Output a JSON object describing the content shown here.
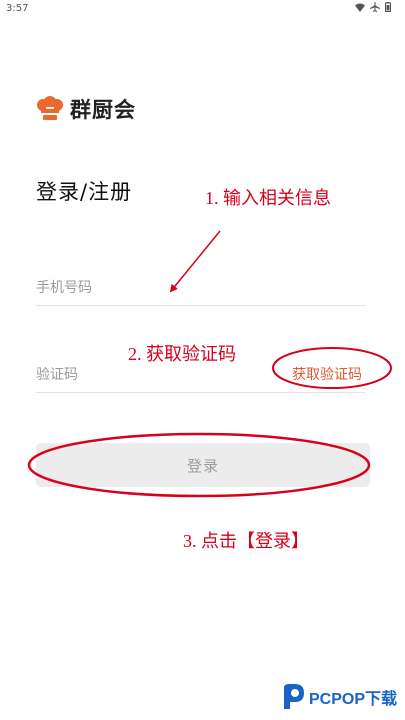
{
  "status_bar": {
    "time": "3:57",
    "icons": [
      "wifi-icon",
      "airplane-icon",
      "battery-icon"
    ]
  },
  "app": {
    "name": "群厨会",
    "brand_color": "#e8682f"
  },
  "page": {
    "title": "登录/注册"
  },
  "form": {
    "phone_placeholder": "手机号码",
    "code_placeholder": "验证码",
    "get_code_label": "获取验证码",
    "login_label": "登录"
  },
  "annotations": {
    "step1": "1. 输入相关信息",
    "step2": "2.  获取验证码",
    "step3": "3. 点击【登录】",
    "color": "#d8001a"
  },
  "watermark": {
    "text": "PCPOP下载",
    "color": "#1a64c8"
  }
}
